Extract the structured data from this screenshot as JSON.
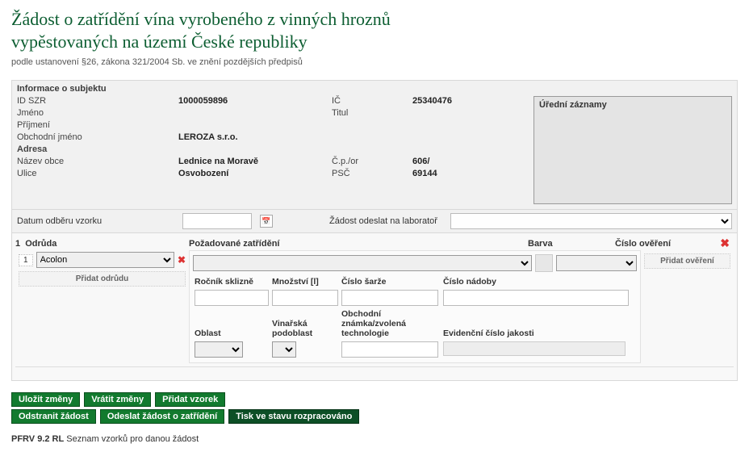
{
  "title_line1": "Žádost o zatřídění vína vyrobeného z vinných hroznů",
  "title_line2": "vypěstovaných na území České republiky",
  "subhead": "podle ustanovení §26, zákona 321/2004 Sb. ve znění pozdějších předpisů",
  "subject": {
    "section_title": "Informace o subjektu",
    "id_label": "ID SZR",
    "id_value": "1000059896",
    "ic_label": "IČ",
    "ic_value": "25340476",
    "jmeno_label": "Jméno",
    "titul_label": "Titul",
    "prijmeni_label": "Příjmení",
    "obchjm_label": "Obchodní jméno",
    "obchjm_value": "LEROZA s.r.o.",
    "adresa_label": "Adresa",
    "obec_label": "Název obce",
    "obec_value": "Lednice na Moravě",
    "cpor_label": "Č.p./or",
    "cpor_value": "606/",
    "ulice_label": "Ulice",
    "ulice_value": "Osvobození",
    "psc_label": "PSČ",
    "psc_value": "69144",
    "notes_label": "Úřední záznamy"
  },
  "datum_row": {
    "datum_label": "Datum odběru vzorku",
    "lab_label": "Žádost odeslat na laboratoř"
  },
  "sample": {
    "num": "1",
    "odruda_head": "Odrůda",
    "zatrideni_head": "Požadované zatřídění",
    "barva_head": "Barva",
    "overeni_head": "Číslo ověření",
    "row_num": "1",
    "odruda_value": "Acolon",
    "add_odrudu": "Přidat odrůdu",
    "add_overeni": "Přidat ověření",
    "col_rocnik": "Ročník sklizně",
    "col_mnozstvi": "Množství [l]",
    "col_sarze": "Číslo šarže",
    "col_nadoby": "Číslo nádoby",
    "col_oblast": "Oblast",
    "col_podoblast": "Vinařská podoblast",
    "col_obchz": "Obchodní známka/zvolená technologie",
    "col_evid": "Evidenční číslo jakosti"
  },
  "buttons": {
    "ulozit": "Uložit změny",
    "vratit": "Vrátit změny",
    "pridat_vzorek": "Přidat vzorek",
    "odstranit": "Odstranit žádost",
    "odeslat": "Odeslat žádost o zatřídění",
    "tisk": "Tisk ve stavu rozpracováno"
  },
  "footer": {
    "code": "PFRV 9.2 RL",
    "text": "Seznam vzorků pro danou žádost"
  }
}
